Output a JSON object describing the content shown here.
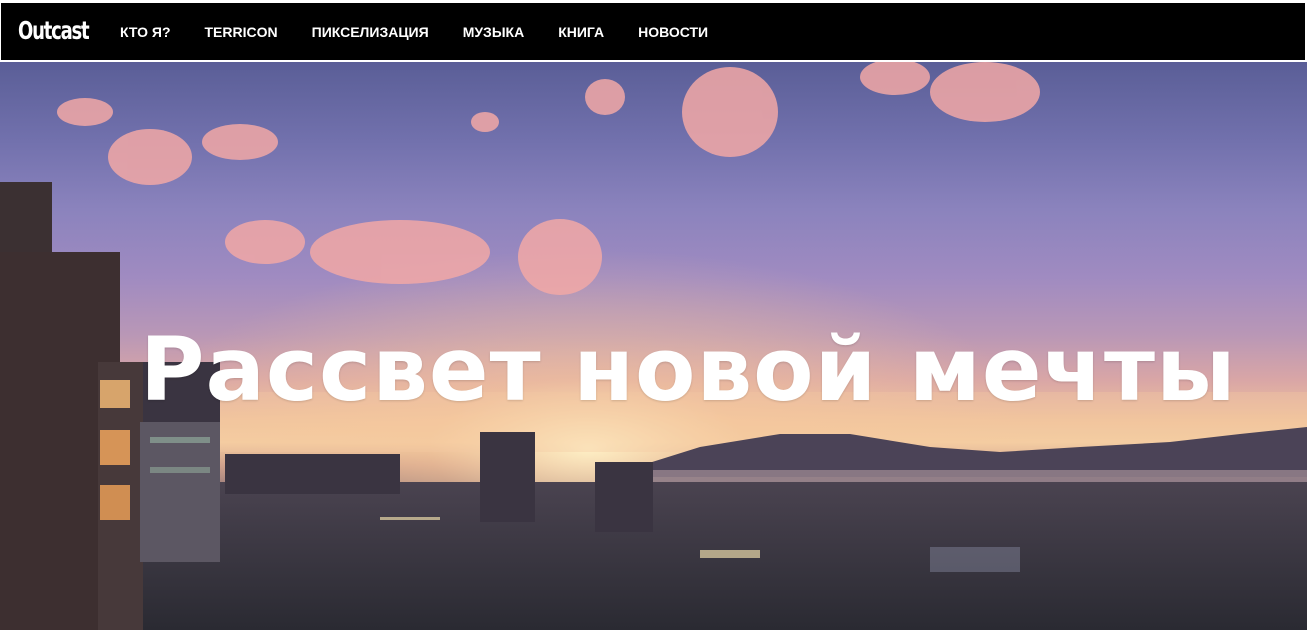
{
  "header": {
    "logo": "Outcast",
    "nav": [
      {
        "label": "КТО Я?"
      },
      {
        "label": "TERRICON"
      },
      {
        "label": "ПИКСЕЛИЗАЦИЯ"
      },
      {
        "label": "МУЗЫКА"
      },
      {
        "label": "КНИГА"
      },
      {
        "label": "НОВОСТИ"
      }
    ]
  },
  "hero": {
    "title": "Рассвет новой мечты",
    "image_alt_semantic": "sunset-city-skyline-photo"
  },
  "colors": {
    "navbar_bg": "#000000",
    "nav_text": "#ffffff",
    "hero_title": "#ffffff"
  }
}
